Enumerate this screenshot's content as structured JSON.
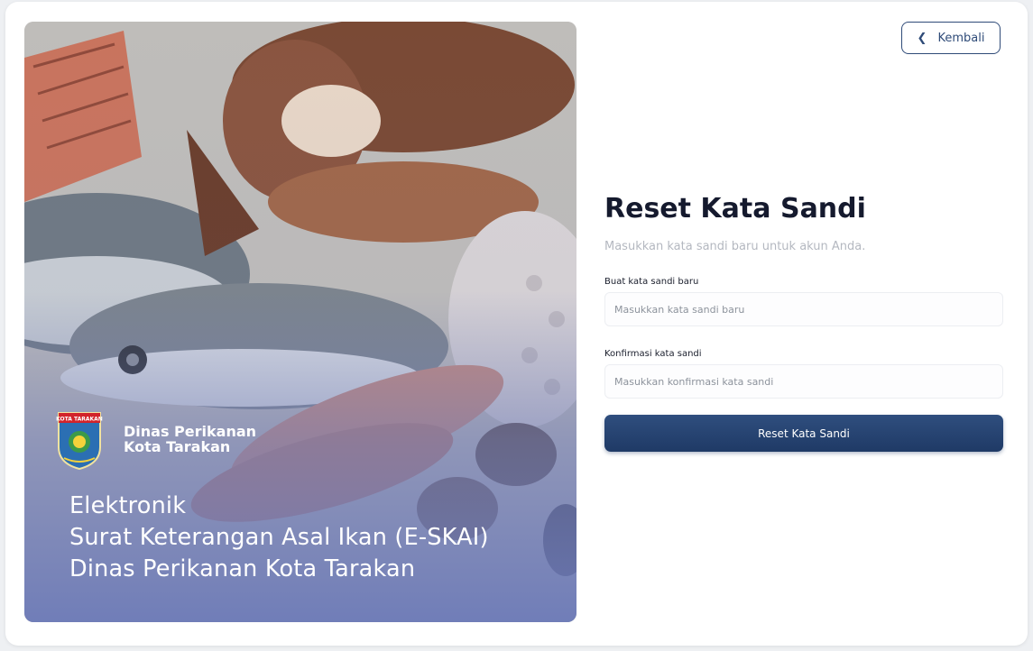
{
  "nav": {
    "back_label": "Kembali",
    "back_icon": "chevron-left-icon"
  },
  "hero": {
    "org_name_line1": "Dinas Perikanan",
    "org_name_line2": "Kota Tarakan",
    "logo_text": "KOTA TARAKAN",
    "tagline_line1": "Elektronik",
    "tagline_line2": "Surat Keterangan Asal Ikan (E-SKAI)",
    "tagline_line3": "Dinas Perikanan Kota Tarakan"
  },
  "form": {
    "title": "Reset Kata Sandi",
    "subtitle": "Masukkan kata sandi baru untuk akun Anda.",
    "new_password_label": "Buat kata sandi baru",
    "new_password_placeholder": "Masukkan kata sandi baru",
    "new_password_value": "",
    "confirm_password_label": "Konfirmasi kata sandi",
    "confirm_password_placeholder": "Masukkan konfirmasi kata sandi",
    "confirm_password_value": "",
    "submit_label": "Reset Kata Sandi"
  },
  "colors": {
    "primary": "#2f4b78",
    "hero_overlay": "#6c7ab8",
    "title": "#151a2e",
    "muted": "#b4b8c0"
  }
}
